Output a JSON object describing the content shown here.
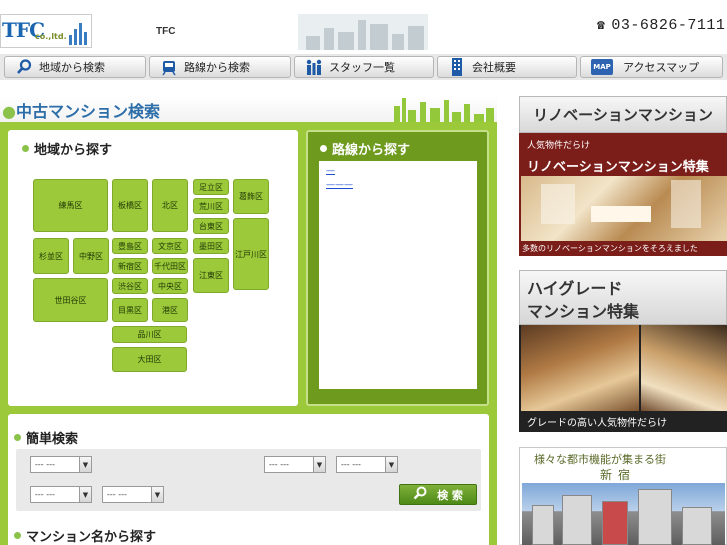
{
  "header": {
    "logo_main": "TFC",
    "logo_sub": "co.,ltd.",
    "site_name": "TFC",
    "phone_icon": "☎",
    "phone": "03-6826-7111"
  },
  "nav": {
    "items": [
      {
        "label": "地域から検索",
        "icon": "magnifier-icon"
      },
      {
        "label": "路線から検索",
        "icon": "train-icon"
      },
      {
        "label": "スタッフ一覧",
        "icon": "staff-icon"
      },
      {
        "label": "会社概要",
        "icon": "building-icon"
      },
      {
        "label": "アクセスマップ",
        "icon": "map-icon",
        "badge": "MAP"
      }
    ]
  },
  "main": {
    "title": "中古マンション検索",
    "area_search": {
      "heading": "地域から探す",
      "wards": [
        "練馬区",
        "板橋区",
        "北区",
        "足立区",
        "葛飾区",
        "荒川区",
        "台東区",
        "杉並区",
        "中野区",
        "豊島区",
        "文京区",
        "墨田区",
        "江戸川区",
        "新宿区",
        "千代田区",
        "江東区",
        "世田谷区",
        "渋谷区",
        "中央区",
        "目黒区",
        "港区",
        "品川区",
        "大田区"
      ]
    },
    "line_search": {
      "heading": "路線から探す",
      "links": [
        "—",
        "———"
      ]
    },
    "simple_search": {
      "heading": "簡単検索",
      "selects": [
        "--- ---",
        "--- ---",
        "--- ---",
        "--- ---",
        "--- ---"
      ],
      "button_label": "検 索"
    },
    "name_search": {
      "heading": "マンション名から探す"
    }
  },
  "sidebar": {
    "renovation": {
      "title": "リノベーションマンション",
      "tagline": "人気物件だらけ",
      "feature": "リノベーションマンション特集",
      "caption": "多数のリノベーションマンションをそろえました"
    },
    "highgrade": {
      "title_line1": "ハイグレード",
      "title_line2": "マンション特集",
      "caption": "グレードの高い人気物件だらけ"
    },
    "shinjuku": {
      "title": "様々な都市機能が集まる街",
      "place": "新宿"
    }
  },
  "colors": {
    "green": "#9cc93a",
    "dark_green": "#6e9a1e",
    "title_blue": "#2d6ea8",
    "banner_red": "#7b1d19"
  }
}
